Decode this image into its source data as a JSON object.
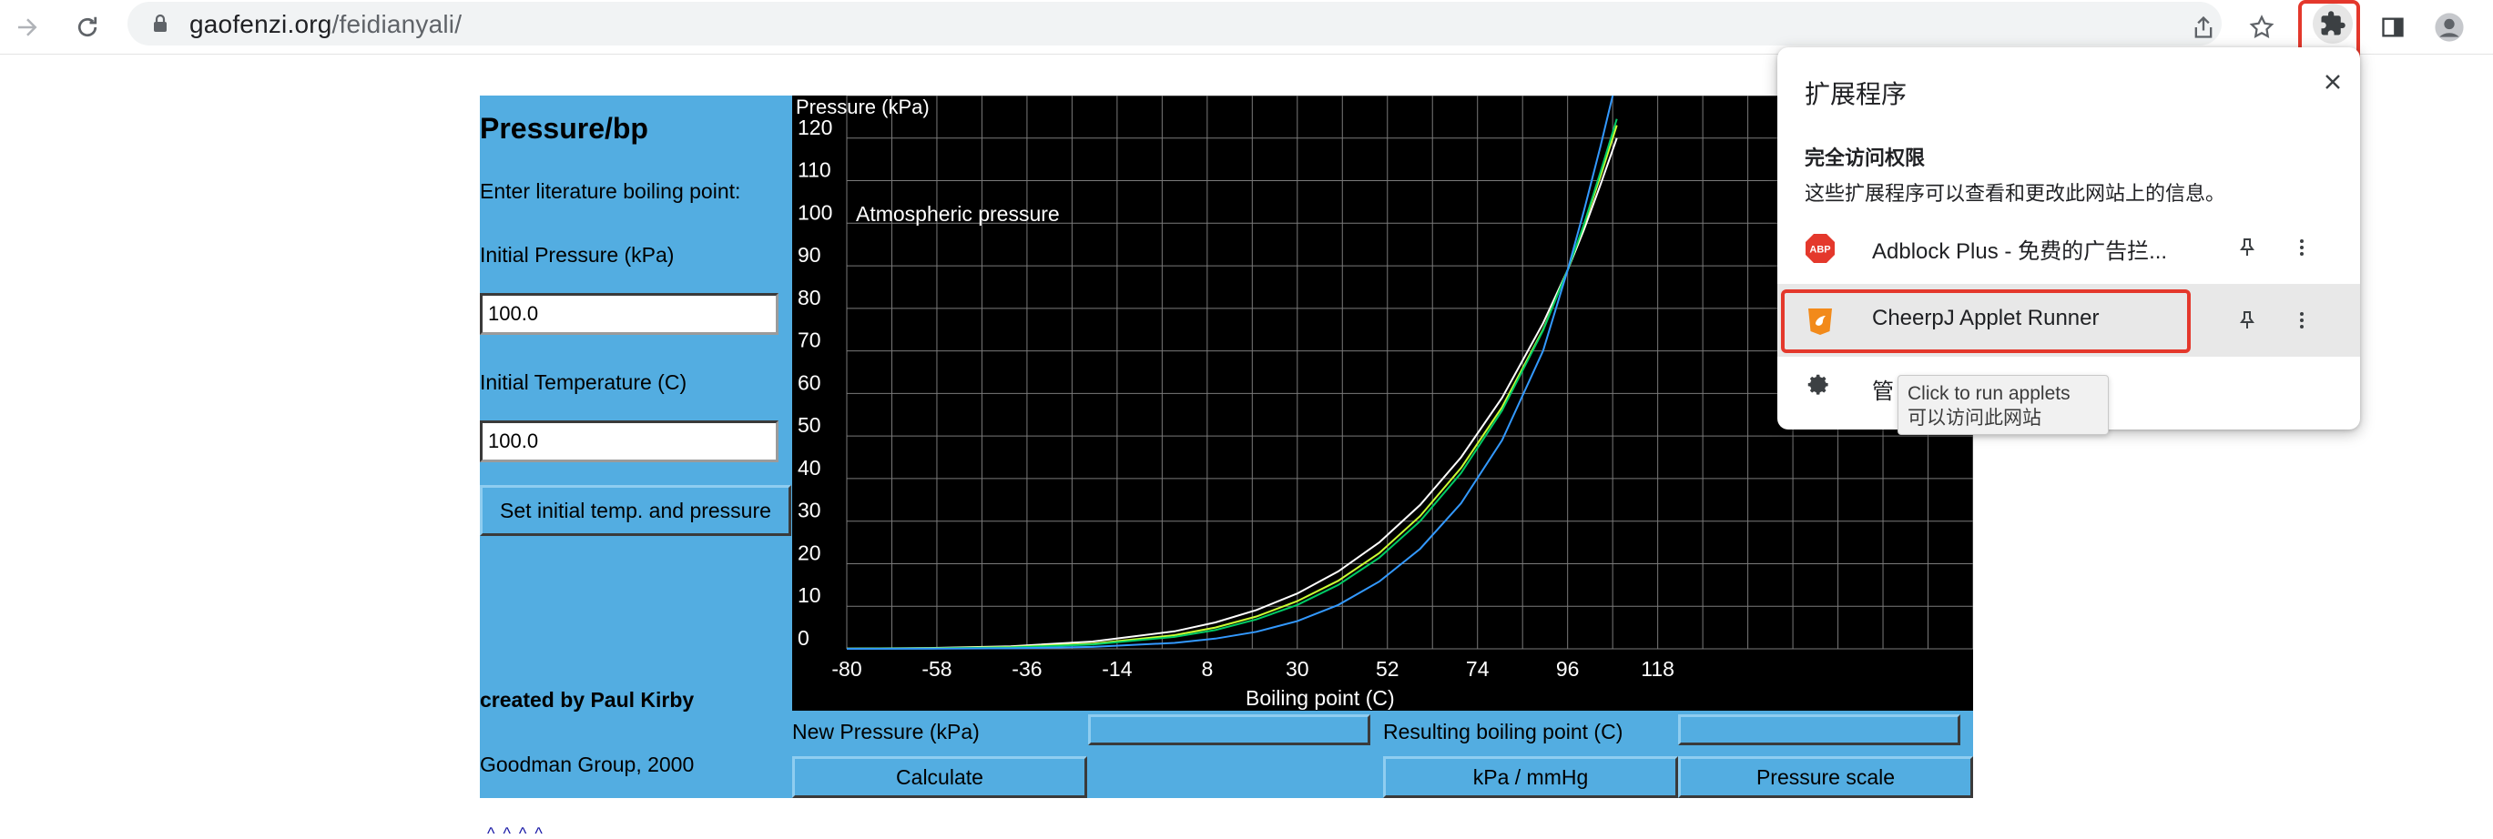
{
  "browser": {
    "url_host": "gaofenzi.org",
    "url_path": "/feidianyali/"
  },
  "applet": {
    "title": "Pressure/bp",
    "enter_label": "Enter literature boiling point:",
    "initial_pressure_label": "Initial Pressure (kPa)",
    "initial_pressure_value": "100.0",
    "initial_temperature_label": "Initial Temperature (C)",
    "initial_temperature_value": "100.0",
    "set_button": "Set initial temp. and pressure",
    "credit_author": "created by Paul Kirby",
    "credit_group": "Goodman Group, 2000",
    "new_pressure_label": "New Pressure (kPa)",
    "new_pressure_value": "",
    "resulting_bp_label": "Resulting boiling point (C)",
    "resulting_bp_value": "",
    "calculate_button": "Calculate",
    "units_button": "kPa / mmHg",
    "scale_button": "Pressure scale",
    "footer_dots": "^ ^ ^ ^"
  },
  "chart_data": {
    "type": "line",
    "ylabel": "Pressure (kPa)",
    "xlabel": "Boiling point (C)",
    "annotation": "Atmospheric pressure",
    "x_ticks": [
      "-80",
      "-58",
      "-36",
      "-14",
      "8",
      "30",
      "52",
      "74",
      "96",
      "118"
    ],
    "y_ticks": [
      "0",
      "10",
      "20",
      "30",
      "40",
      "50",
      "60",
      "70",
      "80",
      "90",
      "100",
      "110",
      "120"
    ],
    "xlim": [
      -80,
      195
    ],
    "ylim": [
      0,
      130
    ],
    "grid": true,
    "series": [
      {
        "color": "#ffffff",
        "x": [
          -80,
          -60,
          -40,
          -20,
          0,
          10,
          20,
          30,
          40,
          50,
          60,
          70,
          80,
          90,
          96,
          100,
          104,
          108
        ],
        "y": [
          0.05,
          0.2,
          0.6,
          1.7,
          4.1,
          6.2,
          9.1,
          13.0,
          18.2,
          25.0,
          33.8,
          45.0,
          59.0,
          76.5,
          89.0,
          98.5,
          109.0,
          120.0
        ]
      },
      {
        "color": "#ccff33",
        "x": [
          -80,
          -60,
          -40,
          -20,
          0,
          10,
          20,
          30,
          40,
          50,
          60,
          70,
          80,
          90,
          96,
          100,
          104,
          108
        ],
        "y": [
          0.03,
          0.12,
          0.42,
          1.2,
          3.2,
          5.0,
          7.6,
          11.2,
          16.0,
          22.5,
          31.2,
          42.5,
          56.8,
          75.0,
          89.0,
          99.5,
          111.0,
          123.0
        ]
      },
      {
        "color": "#00cc66",
        "x": [
          -80,
          -60,
          -40,
          -20,
          0,
          10,
          20,
          30,
          40,
          50,
          60,
          70,
          80,
          90,
          96,
          100,
          104,
          108
        ],
        "y": [
          0.02,
          0.09,
          0.33,
          1.0,
          2.8,
          4.4,
          6.9,
          10.3,
          15.0,
          21.4,
          30.0,
          41.3,
          56.0,
          74.8,
          89.0,
          99.8,
          112.0,
          124.5
        ]
      },
      {
        "color": "#3399ff",
        "x": [
          -80,
          -60,
          -40,
          -20,
          0,
          10,
          20,
          30,
          40,
          50,
          60,
          70,
          80,
          90,
          96,
          100,
          104,
          108
        ],
        "y": [
          0.0,
          0.03,
          0.12,
          0.45,
          1.4,
          2.4,
          4.0,
          6.5,
          10.3,
          15.8,
          23.5,
          34.2,
          49.0,
          70.0,
          89.0,
          103.0,
          118.0,
          134.0
        ]
      }
    ]
  },
  "extensions_popup": {
    "title": "扩展程序",
    "section_title": "完全访问权限",
    "section_desc": "这些扩展程序可以查看和更改此网站上的信息。",
    "items": [
      {
        "name": "Adblock Plus - 免费的广告拦...",
        "icon": "abp-icon",
        "color": "#e4382c"
      },
      {
        "name": "CheerpJ Applet Runner",
        "icon": "cheerpj-icon",
        "color": "#f28a1a"
      }
    ],
    "manage_label": "管",
    "tooltip_line1": "Click to run applets",
    "tooltip_line2": "可以访问此网站"
  }
}
